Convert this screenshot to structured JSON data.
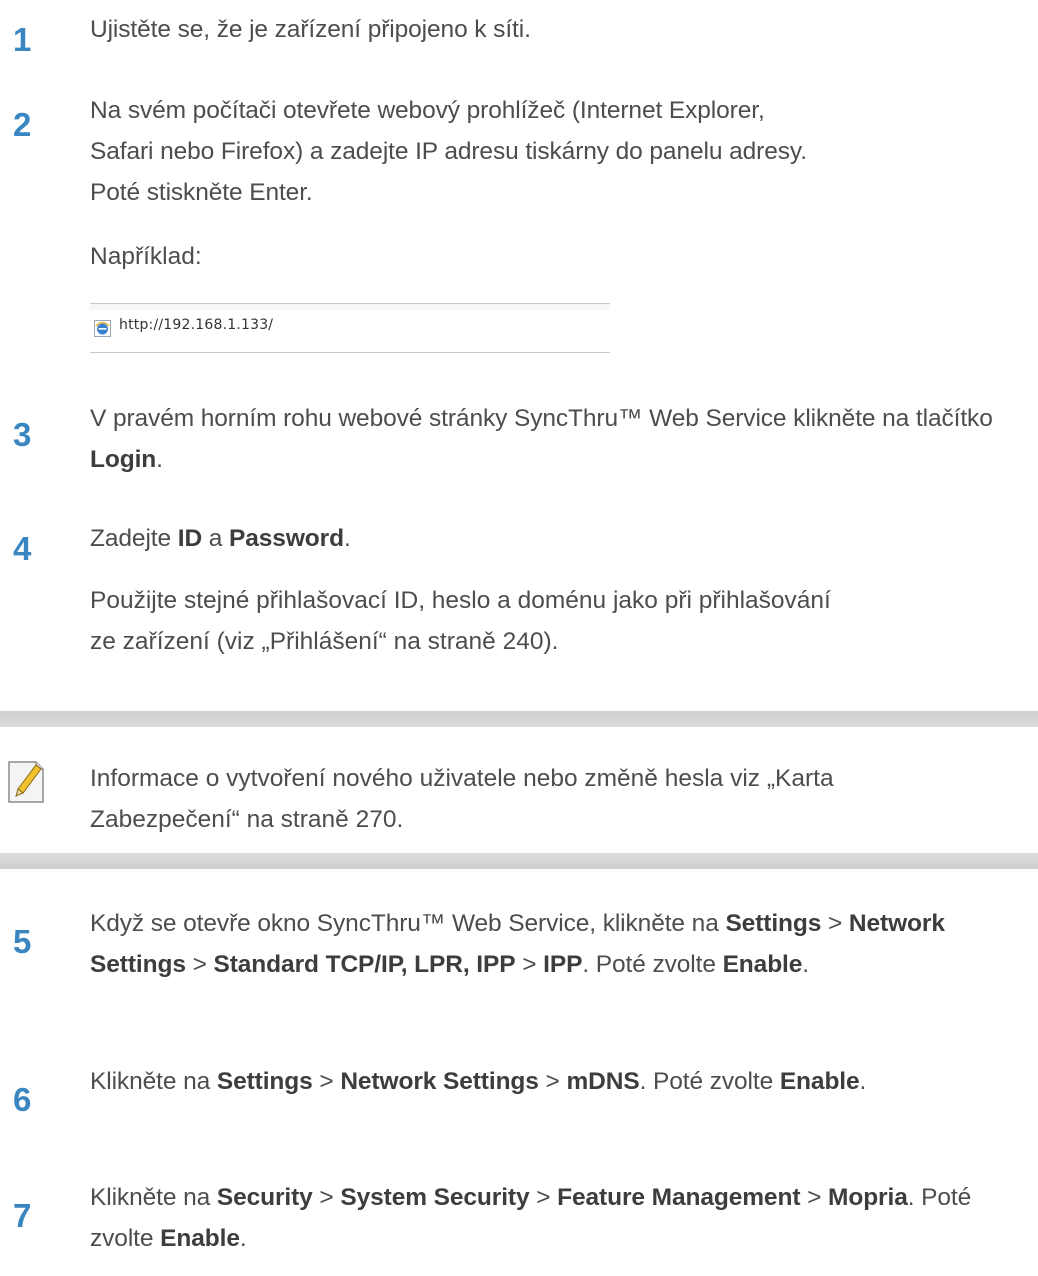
{
  "steps": [
    {
      "num": "1",
      "text": "Ujistěte se, že je zařízení připojeno k síti."
    },
    {
      "num": "2",
      "line1": "Na svém počítači otevřete webový prohlížeč (Internet Explorer,",
      "line2": "Safari nebo Firefox) a zadejte IP adresu tiskárny do panelu adresy.",
      "line3": "Poté stiskněte Enter.",
      "example": "Například:"
    },
    {
      "num": "3",
      "pre": "V pravém horním rohu webové stránky SyncThru™ Web Service klikněte na tlačítko ",
      "b1": "Login",
      "post": "."
    },
    {
      "num": "4",
      "pre": "Zadejte ",
      "b1": "ID",
      "mid": " a ",
      "b2": "Password",
      "post": ".",
      "sub1": "Použijte stejné přihlašovací ID, heslo a doménu jako při přihlašování",
      "sub2": "ze zařízení (viz „Přihlášení“ na straně 240)."
    },
    {
      "num": "5",
      "t1": "Když se otevře okno SyncThru™ Web Service, klikněte na ",
      "b1": "Settings",
      "t2": " > ",
      "b2": "Network Settings",
      "t3": " > ",
      "b3": "Standard TCP/IP, LPR, IPP",
      "t4": " > ",
      "b4": "IPP",
      "t5": ". Poté zvolte ",
      "b5": "Enable",
      "t6": "."
    },
    {
      "num": "6",
      "t1": "Klikněte na ",
      "b1": "Settings",
      "t2": " > ",
      "b2": "Network Settings",
      "t3": " > ",
      "b3": "mDNS",
      "t4": ". Poté zvolte ",
      "b4": "Enable",
      "t5": "."
    },
    {
      "num": "7",
      "t1": "Klikněte na ",
      "b1": "Security",
      "t2": " > ",
      "b2": "System Security",
      "t3": " > ",
      "b3": "Feature Management",
      "t4": " > ",
      "b4": "Mopria",
      "t5": ". Poté zvolte ",
      "b5": "Enable",
      "t6": "."
    }
  ],
  "address_bar": {
    "url": "http://192.168.1.133/",
    "icon": "ie-browser-icon"
  },
  "note": {
    "icon": "note-pencil-icon",
    "line1": "Informace o vytvoření nového uživatele nebo změně hesla viz „Karta",
    "line2": "Zabezpečení“ na straně 270."
  },
  "colors": {
    "step_number": "#3a86c0",
    "text": "#4d4d4d",
    "note_bar": "#d5d5d5"
  }
}
